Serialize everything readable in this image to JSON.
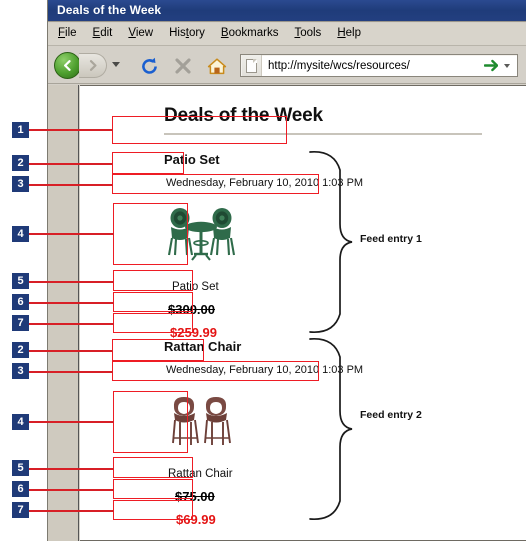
{
  "window": {
    "title": "Deals of the Week",
    "menu": [
      {
        "label": "File",
        "accel": "F"
      },
      {
        "label": "Edit",
        "accel": "E"
      },
      {
        "label": "View",
        "accel": "V"
      },
      {
        "label": "History",
        "accel": "t"
      },
      {
        "label": "Bookmarks",
        "accel": "B"
      },
      {
        "label": "Tools",
        "accel": "T"
      },
      {
        "label": "Help",
        "accel": "H"
      }
    ],
    "toolbar": {
      "back_icon": "back-arrow-icon",
      "forward_icon": "forward-arrow-icon",
      "dropdown_icon": "chevron-down-icon",
      "reload_icon": "reload-icon",
      "stop_icon": "stop-icon",
      "home_icon": "home-icon"
    },
    "address": {
      "url": "http://mysite/wcs/resources/",
      "favicon": "page-icon",
      "go_icon": "go-arrow-icon",
      "history_icon": "chevron-down-icon"
    }
  },
  "page": {
    "heading": "Deals of the Week",
    "entries": [
      {
        "title": "Patio Set",
        "date": "Wednesday, February 10, 2010 1:03 PM",
        "image": "patio-set-image",
        "product_name": "Patio Set",
        "old_price": "$300.00",
        "new_price": "$259.99"
      },
      {
        "title": "Rattan Chair",
        "date": "Wednesday, February 10, 2010 1:03 PM",
        "image": "rattan-chair-image",
        "product_name": "Rattan Chair",
        "old_price": "$75.00",
        "new_price": "$69.99"
      }
    ]
  },
  "annotations": {
    "badges": [
      {
        "n": "1"
      },
      {
        "n": "2"
      },
      {
        "n": "3"
      },
      {
        "n": "4"
      },
      {
        "n": "5"
      },
      {
        "n": "6"
      },
      {
        "n": "7"
      },
      {
        "n": "2"
      },
      {
        "n": "3"
      },
      {
        "n": "4"
      },
      {
        "n": "5"
      },
      {
        "n": "6"
      },
      {
        "n": "7"
      }
    ],
    "brace_labels": [
      "Feed entry 1",
      "Feed entry 2"
    ]
  },
  "colors": {
    "titlebar": "#22407d",
    "badge": "#1f3a78",
    "callout_red": "#ee1c24",
    "sale_price": "#e41313",
    "chrome": "#d4d0c8"
  }
}
